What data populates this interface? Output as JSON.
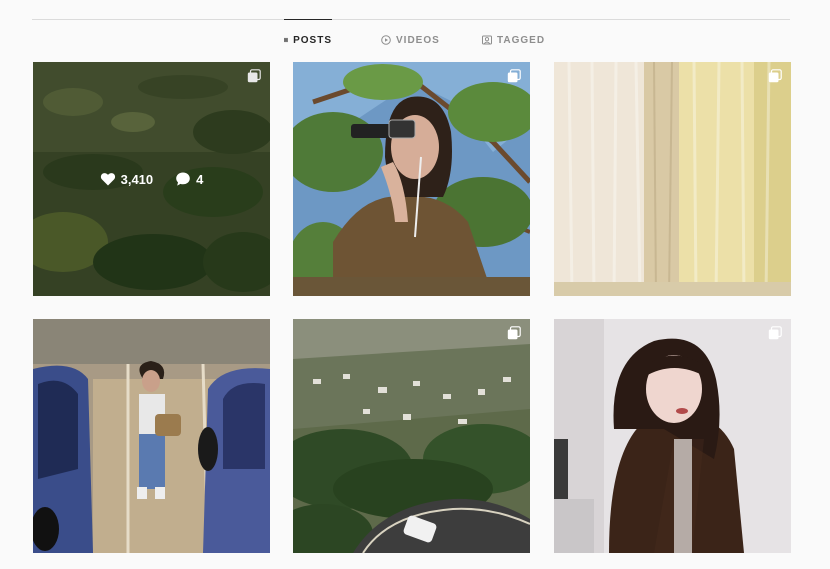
{
  "tabs": [
    {
      "label": "POSTS",
      "icon": "grid-icon",
      "active": true
    },
    {
      "label": "VIDEOS",
      "icon": "play-circle-icon",
      "active": false
    },
    {
      "label": "TAGGED",
      "icon": "tag-person-icon",
      "active": false
    }
  ],
  "posts": [
    {
      "id": "grass-field",
      "multiple": true,
      "likes": "3,410",
      "comments": "4",
      "hovered": true
    },
    {
      "id": "sunglasses-tree",
      "multiple": true
    },
    {
      "id": "curtains-window",
      "multiple": true
    },
    {
      "id": "parking-lot",
      "multiple": false
    },
    {
      "id": "hills-aerial",
      "multiple": true
    },
    {
      "id": "brown-jacket-portrait",
      "multiple": true
    }
  ],
  "colors": {
    "accent_text": "#262626",
    "muted_text": "#8e8e8e",
    "divider": "#dbdbdb",
    "background": "#fafafa"
  }
}
